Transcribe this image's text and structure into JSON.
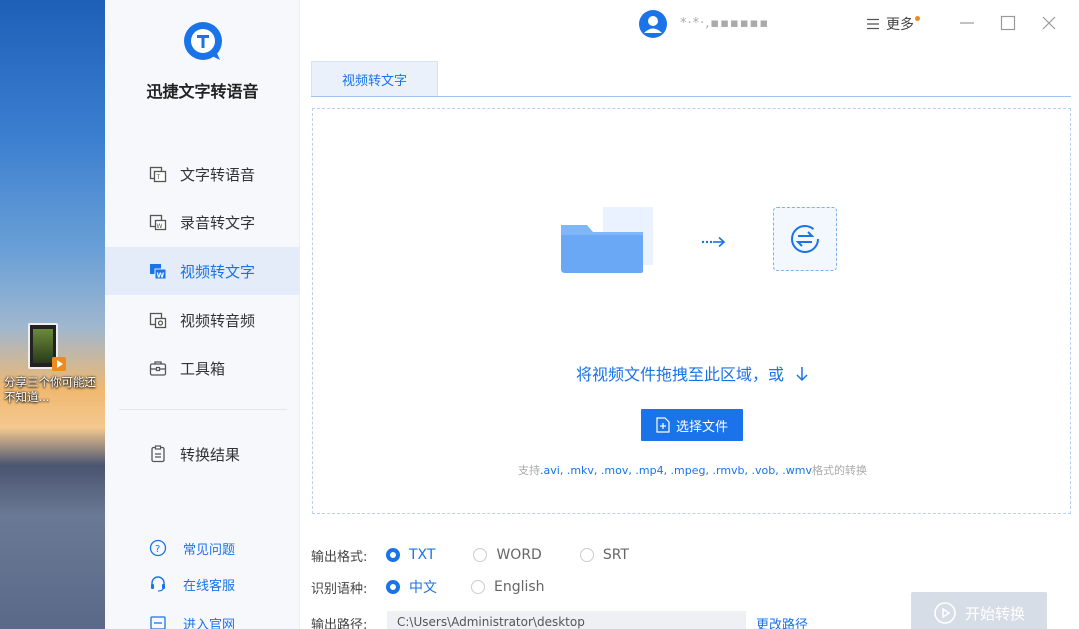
{
  "desktop": {
    "icon_label": "分享三个你可能还不知道..."
  },
  "app": {
    "name": "迅捷文字转语音"
  },
  "nav": {
    "items": [
      {
        "label": "文字转语音",
        "icon": "text-to-speech-icon"
      },
      {
        "label": "录音转文字",
        "icon": "recording-to-text-icon"
      },
      {
        "label": "视频转文字",
        "icon": "video-to-text-icon",
        "active": true
      },
      {
        "label": "视频转音频",
        "icon": "video-to-audio-icon"
      },
      {
        "label": "工具箱",
        "icon": "toolbox-icon"
      }
    ],
    "results_label": "转换结果"
  },
  "help": {
    "faq": "常见问题",
    "service": "在线客服",
    "website": "进入官网"
  },
  "topbar": {
    "username": "*·*·,▪▪▪▪▪▪",
    "more_label": "更多"
  },
  "tab": {
    "label": "视频转文字"
  },
  "dropzone": {
    "hint": "将视频文件拖拽至此区域，或",
    "select_button": "选择文件",
    "formats_prefix": "支持",
    "formats_list": ".avi, .mkv, .mov, .mp4, .mpeg, .rmvb, .vob, .wmv",
    "formats_suffix": "格式的转换"
  },
  "options": {
    "output_format_label": "输出格式:",
    "formats": [
      "TXT",
      "WORD",
      "SRT"
    ],
    "selected_format": "TXT",
    "language_label": "识别语种:",
    "languages": [
      "中文",
      "English"
    ],
    "selected_language": "中文",
    "output_path_label": "输出路径:",
    "output_path": "C:\\Users\\Administrator\\desktop",
    "change_path": "更改路径"
  },
  "start_button": "开始转换",
  "colors": {
    "accent": "#1a73e8",
    "sidebar_bg": "#f6f8fb",
    "active_bg": "#e3ecf8",
    "disabled_button": "#d7dde6"
  }
}
